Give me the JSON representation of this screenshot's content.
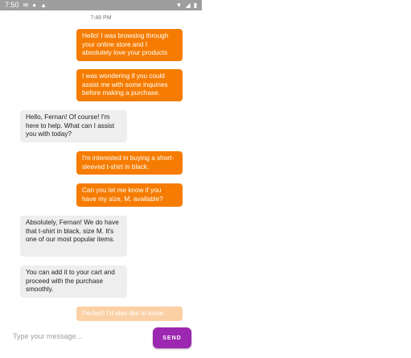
{
  "status_bar": {
    "time": "7:50",
    "icons": [
      "gmail-icon",
      "notification-icon",
      "notification-icon",
      "wifi-icon",
      "signal-icon",
      "battery-icon"
    ]
  },
  "chat": {
    "timestamp": "7:48 PM",
    "messages": [
      {
        "sender": "user",
        "text": "Hello! I was browsing through your online store and I absolutely love your products"
      },
      {
        "sender": "user",
        "text": "I was wondering if you could assist me with some inquiries before making a purchase."
      },
      {
        "sender": "bot",
        "text": "Hello, Fernan! Of course! I'm here to help. What can I assist you with today?"
      },
      {
        "sender": "user",
        "text": "I'm interested in buying a short-sleeved t-shirt in black."
      },
      {
        "sender": "user",
        "text": "Can you let me know if you have my size, M, available?"
      },
      {
        "sender": "bot",
        "text": "Absolutely, Fernan! We do have that t-shirt in black, size M. It's one of our most popular items."
      },
      {
        "sender": "bot",
        "text": "You can add it to your cart and proceed with the purchase smoothly."
      },
      {
        "sender": "user",
        "text": "Perfect! I'd also like to know"
      }
    ]
  },
  "composer": {
    "placeholder": "Type your message...",
    "send_label": "SEND"
  },
  "colors": {
    "sent_bubble": "#f57c00",
    "received_bubble": "#eeeeee",
    "send_button": "#9c27b0",
    "status_bar": "#9e9e9e"
  }
}
